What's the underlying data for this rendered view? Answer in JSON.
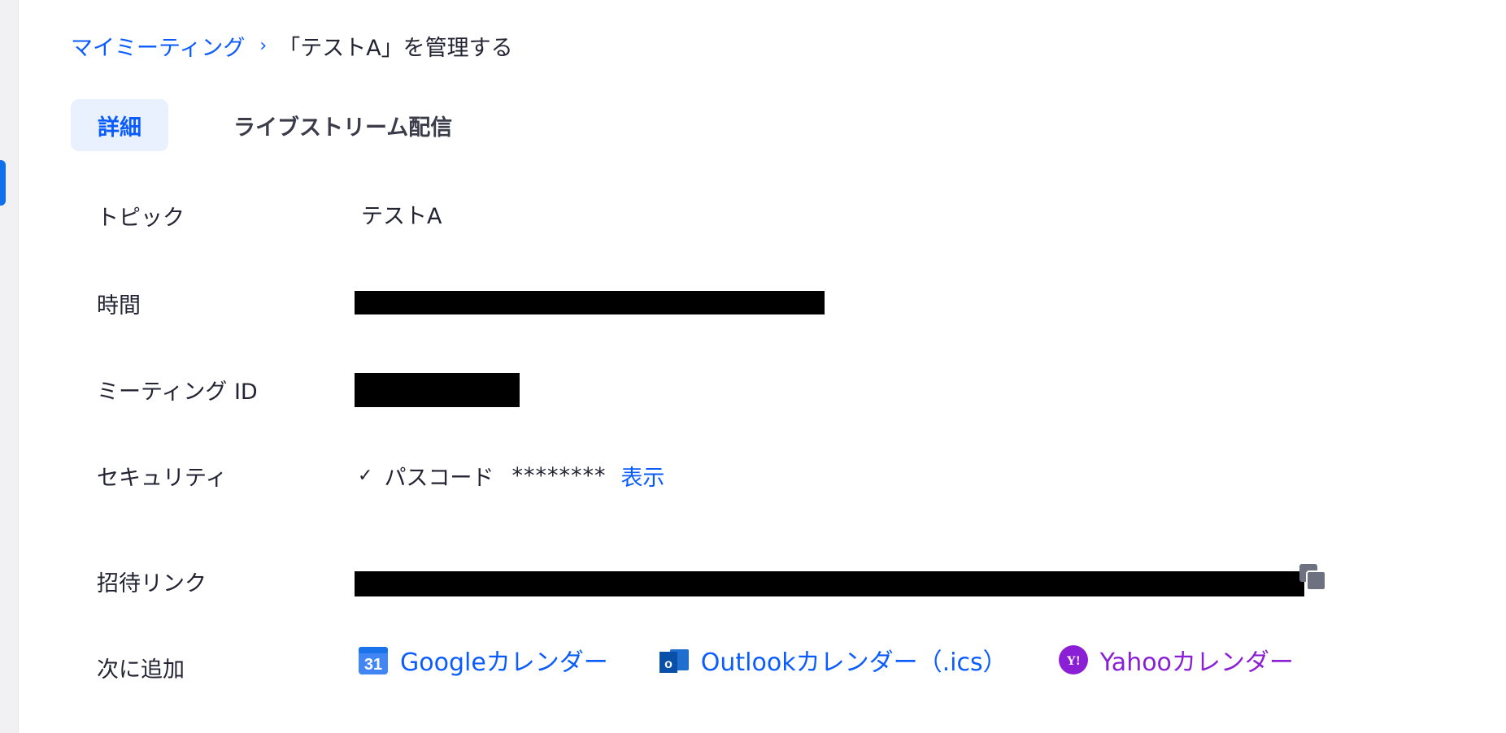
{
  "breadcrumb": {
    "parent": "マイミーティング",
    "separator": "›",
    "current": "「テストA」を管理する"
  },
  "tabs": [
    {
      "label": "詳細",
      "active": true
    },
    {
      "label": "ライブストリーム配信",
      "active": false
    }
  ],
  "details": {
    "topic": {
      "label": "トピック",
      "value": "テストA"
    },
    "time": {
      "label": "時間"
    },
    "meeting_id": {
      "label": "ミーティング ID"
    },
    "security": {
      "label": "セキュリティ",
      "check": "✓",
      "passcode_label": "パスコード",
      "passcode_mask": "********",
      "show_label": "表示"
    },
    "invite_link": {
      "label": "招待リンク"
    },
    "add_to": {
      "label": "次に追加",
      "google": "Googleカレンダー",
      "outlook": "Outlookカレンダー（.ics）",
      "yahoo": "Yahooカレンダー"
    }
  },
  "colors": {
    "accent": "#0b5cff",
    "yahoo": "#8a1fd6",
    "active_tab_bg": "#e8f1fd",
    "redaction": "#000000"
  },
  "icons": {
    "copy": "copy-icon",
    "google": "google-calendar-icon",
    "outlook": "outlook-icon",
    "yahoo": "yahoo-icon",
    "chevron": "chevron-right-icon",
    "check": "checkmark-icon"
  }
}
